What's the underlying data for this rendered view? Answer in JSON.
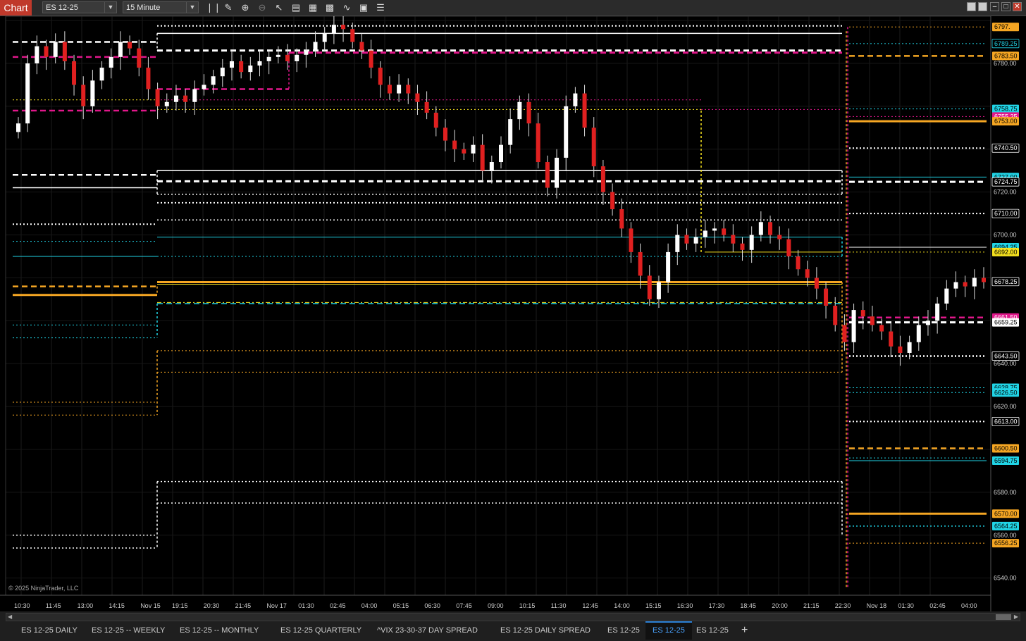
{
  "window": {
    "app_label": "Chart",
    "instrument": "ES 12-25",
    "timeframe": "15 Minute",
    "toolbar_icons": [
      "bar-style-icon",
      "pencil-icon",
      "zoom-in-icon",
      "zoom-out-icon",
      "pointer-icon",
      "properties-icon",
      "data-box-icon",
      "strategies-icon",
      "indicators-icon",
      "share-icon",
      "list-icon"
    ],
    "window_buttons": [
      "tile-icon",
      "tile2-icon",
      "minimize-icon",
      "maximize-icon",
      "close-icon"
    ]
  },
  "chart": {
    "copyright": "© 2025 NinjaTrader, LLC",
    "time_labels": [
      "10:30",
      "11:45",
      "13:00",
      "14:15",
      "Nov 15",
      "19:15",
      "20:30",
      "21:45",
      "Nov 17",
      "01:30",
      "02:45",
      "04:00",
      "05:15",
      "06:30",
      "07:45",
      "09:00",
      "10:15",
      "11:30",
      "12:45",
      "14:00",
      "15:15",
      "16:30",
      "17:30",
      "18:45",
      "20:00",
      "21:15",
      "22:30",
      "Nov 18",
      "01:30",
      "02:45",
      "04:00"
    ],
    "price_labels": [
      {
        "text": "6780.00",
        "color": "#cccccc",
        "fill": false
      },
      {
        "text": "6720.00",
        "color": "#cccccc",
        "fill": false
      },
      {
        "text": "6700.00",
        "color": "#cccccc",
        "fill": false
      },
      {
        "text": "6620.00",
        "color": "#cccccc",
        "fill": false
      },
      {
        "text": "6580.00",
        "color": "#cccccc",
        "fill": false
      },
      {
        "text": "6560.00",
        "color": "#cccccc",
        "fill": false
      },
      {
        "text": "6540.00",
        "color": "#cccccc",
        "fill": false
      },
      {
        "text": "6640.00",
        "color": "#cccccc",
        "fill": false
      }
    ],
    "price_tags": [
      {
        "text": "6797.",
        "bg": "#f5a623",
        "fg": "#000000"
      },
      {
        "text": "6789.25",
        "bg": "#000000",
        "fg": "#21d4e6",
        "border": "#21d4e6"
      },
      {
        "text": "6783.50",
        "bg": "#f5a623",
        "fg": "#000000"
      },
      {
        "text": "6758.75",
        "bg": "#21d4e6",
        "fg": "#000000"
      },
      {
        "text": "6755.25",
        "bg": "#e0178a",
        "fg": "#ffffff"
      },
      {
        "text": "6753.00",
        "bg": "#f5a623",
        "fg": "#000000"
      },
      {
        "text": "6740.50",
        "bg": "#000000",
        "fg": "#ffffff",
        "border": "#ffffff"
      },
      {
        "text": "6727.00",
        "bg": "#21d4e6",
        "fg": "#000000"
      },
      {
        "text": "6724.75",
        "bg": "#000000",
        "fg": "#ffffff",
        "border": "#ffffff"
      },
      {
        "text": "6710.00",
        "bg": "#000000",
        "fg": "#ffffff",
        "border": "#ffffff"
      },
      {
        "text": "6694.25",
        "bg": "#21d4e6",
        "fg": "#000000"
      },
      {
        "text": "6692.00",
        "bg": "#f5e11e",
        "fg": "#000000"
      },
      {
        "text": "6678.25",
        "bg": "#000000",
        "fg": "#ffffff",
        "border": "#ffffff"
      },
      {
        "text": "6661.50",
        "bg": "#e0178a",
        "fg": "#ffffff"
      },
      {
        "text": "6659.25",
        "bg": "#ffffff",
        "fg": "#000000"
      },
      {
        "text": "6643.50",
        "bg": "#000000",
        "fg": "#ffffff",
        "border": "#ffffff"
      },
      {
        "text": "6628.75",
        "bg": "#21d4e6",
        "fg": "#000000"
      },
      {
        "text": "6626.50",
        "bg": "#21d4e6",
        "fg": "#000000"
      },
      {
        "text": "6613.00",
        "bg": "#000000",
        "fg": "#ffffff",
        "border": "#ffffff"
      },
      {
        "text": "6600.50",
        "bg": "#f5a623",
        "fg": "#000000"
      },
      {
        "text": "6594.75",
        "bg": "#21d4e6",
        "fg": "#000000"
      },
      {
        "text": "6570.00",
        "bg": "#f5a623",
        "fg": "#000000"
      },
      {
        "text": "6564.25",
        "bg": "#21d4e6",
        "fg": "#000000"
      },
      {
        "text": "6556.25",
        "bg": "#f5a623",
        "fg": "#000000"
      }
    ],
    "colors": {
      "up": "#ffffff",
      "down": "#e02020",
      "orange": "#f5a623",
      "cyan": "#21d4e6",
      "magenta": "#e0178a",
      "yellow": "#f5e11e",
      "white": "#ffffff"
    }
  },
  "chart_data": {
    "type": "candlestick",
    "instrument": "ES 12-25",
    "interval": "15 Minute",
    "ylim": [
      6532,
      6802
    ],
    "key_levels": [
      6797.0,
      6789.25,
      6783.5,
      6758.75,
      6755.25,
      6753.0,
      6740.5,
      6727.0,
      6724.75,
      6710.0,
      6694.25,
      6692.0,
      6678.25,
      6661.5,
      6659.25,
      6643.5,
      6628.75,
      6626.5,
      6613.0,
      6600.5,
      6594.75,
      6570.0,
      6564.25,
      6556.25
    ],
    "closes": [
      6752,
      6780,
      6788,
      6783,
      6790,
      6781,
      6770,
      6760,
      6772,
      6778,
      6783,
      6790,
      6787,
      6778,
      6768,
      6760,
      6762,
      6765,
      6762,
      6768,
      6770,
      6774,
      6778,
      6781,
      6776,
      6779,
      6781,
      6783,
      6784,
      6781,
      6784,
      6786,
      6790,
      6794,
      6798,
      6796,
      6790,
      6786,
      6778,
      6770,
      6766,
      6770,
      6766,
      6762,
      6757,
      6750,
      6744,
      6740,
      6738,
      6742,
      6730,
      6734,
      6742,
      6754,
      6762,
      6752,
      6734,
      6722,
      6736,
      6760,
      6766,
      6750,
      6732,
      6720,
      6712,
      6703,
      6692,
      6681,
      6670,
      6678,
      6692,
      6700,
      6696,
      6699,
      6702,
      6703,
      6700,
      6696,
      6693,
      6700,
      6706,
      6700,
      6698,
      6690,
      6684,
      6680,
      6675,
      6667,
      6658,
      6650,
      6665,
      6662,
      6658,
      6655,
      6648,
      6645,
      6650,
      6658,
      6660,
      6668,
      6675,
      6678,
      6676,
      6680,
      6678
    ]
  }
}
